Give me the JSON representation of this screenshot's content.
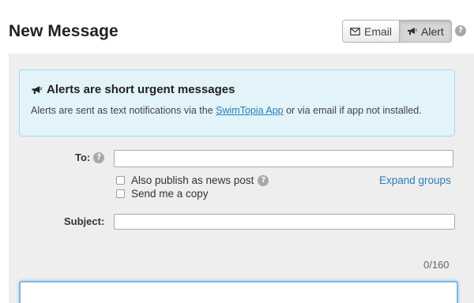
{
  "header": {
    "title": "New Message"
  },
  "mode_toggle": {
    "email_label": "Email",
    "alert_label": "Alert",
    "active": "alert",
    "email_icon": "envelope-icon",
    "alert_icon": "megaphone-icon"
  },
  "help_icon": "?",
  "info_box": {
    "icon": "megaphone-icon",
    "title": "Alerts are short urgent messages",
    "text_before": "Alerts are sent as text notifications via the ",
    "link_text": "SwimTopia App",
    "text_after": " or via email if app not installed."
  },
  "form": {
    "to_label": "To:",
    "to_value": "",
    "publish_news_label": "Also publish as news post",
    "send_copy_label": "Send me a copy",
    "expand_groups_label": "Expand groups",
    "subject_label": "Subject:",
    "subject_value": "",
    "char_count": "0/160",
    "message_value": ""
  },
  "colors": {
    "link": "#2a7fb3",
    "info_bg": "#e2f3fa",
    "info_border": "#a7dbea",
    "panel_bg": "#eeeeee"
  }
}
